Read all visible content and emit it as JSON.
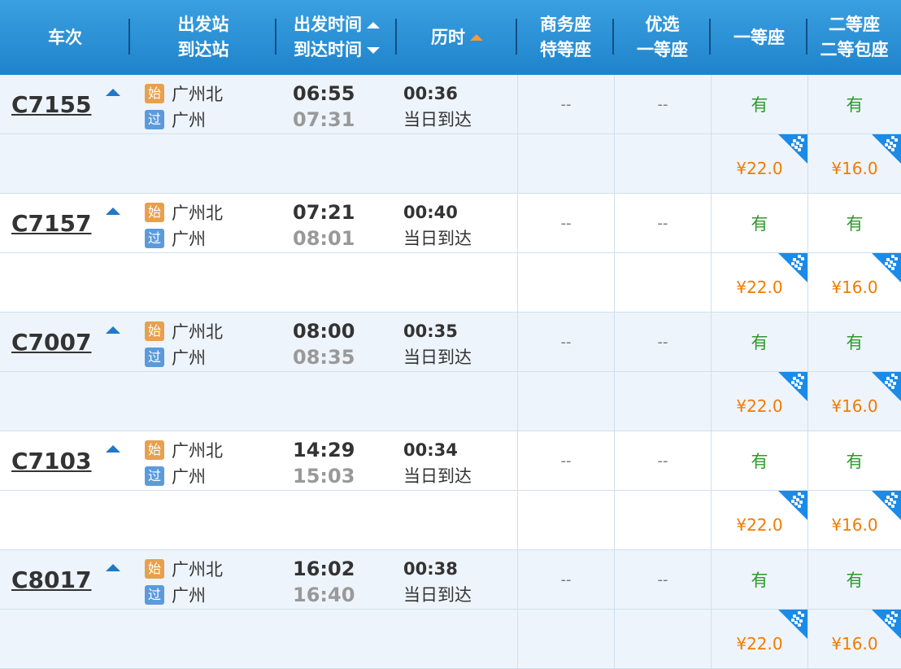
{
  "header": {
    "train": "车次",
    "depart_station": "出发站",
    "arrive_station": "到达站",
    "depart_time": "出发时间",
    "arrive_time": "到达时间",
    "duration": "历时",
    "business_line1": "商务座",
    "business_line2": "特等座",
    "premium_line1": "优选",
    "premium_line2": "一等座",
    "first_class": "一等座",
    "second_line1": "二等座",
    "second_line2": "二等包座"
  },
  "rows": [
    {
      "code": "C7155",
      "from": "广州北",
      "to": "广州",
      "from_badge": "始",
      "to_badge": "过",
      "dep": "06:55",
      "arr": "07:31",
      "duration": "00:36",
      "arrival_note": "当日到达",
      "business": "--",
      "premium": "--",
      "first": "有",
      "second": "有",
      "first_price": "¥22.0",
      "second_price": "¥16.0"
    },
    {
      "code": "C7157",
      "from": "广州北",
      "to": "广州",
      "from_badge": "始",
      "to_badge": "过",
      "dep": "07:21",
      "arr": "08:01",
      "duration": "00:40",
      "arrival_note": "当日到达",
      "business": "--",
      "premium": "--",
      "first": "有",
      "second": "有",
      "first_price": "¥22.0",
      "second_price": "¥16.0"
    },
    {
      "code": "C7007",
      "from": "广州北",
      "to": "广州",
      "from_badge": "始",
      "to_badge": "过",
      "dep": "08:00",
      "arr": "08:35",
      "duration": "00:35",
      "arrival_note": "当日到达",
      "business": "--",
      "premium": "--",
      "first": "有",
      "second": "有",
      "first_price": "¥22.0",
      "second_price": "¥16.0"
    },
    {
      "code": "C7103",
      "from": "广州北",
      "to": "广州",
      "from_badge": "始",
      "to_badge": "过",
      "dep": "14:29",
      "arr": "15:03",
      "duration": "00:34",
      "arrival_note": "当日到达",
      "business": "--",
      "premium": "--",
      "first": "有",
      "second": "有",
      "first_price": "¥22.0",
      "second_price": "¥16.0"
    },
    {
      "code": "C8017",
      "from": "广州北",
      "to": "广州",
      "from_badge": "始",
      "to_badge": "过",
      "dep": "16:02",
      "arr": "16:40",
      "duration": "00:38",
      "arrival_note": "当日到达",
      "business": "--",
      "premium": "--",
      "first": "有",
      "second": "有",
      "first_price": "¥22.0",
      "second_price": "¥16.0"
    }
  ]
}
